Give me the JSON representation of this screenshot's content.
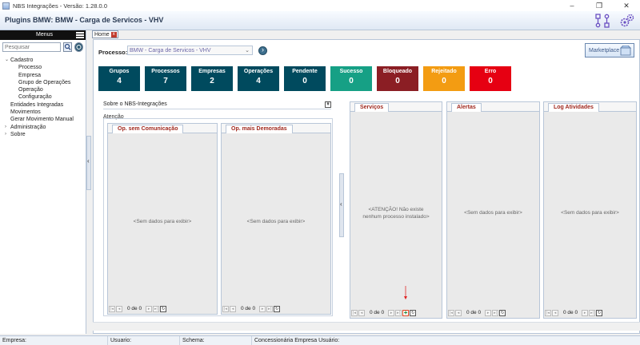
{
  "window": {
    "title": "NBS Integrações - Versão: 1.28.0.0",
    "controls": [
      "–",
      "❐",
      "✕"
    ]
  },
  "header": {
    "title": "Plugins BMW: BMW - Carga de Servicos - VHV",
    "icons": [
      "workflow-icon",
      "gears-icon"
    ]
  },
  "sidebar": {
    "menus_label": "Menus",
    "search_placeholder": "Pesquisar",
    "tree": [
      {
        "label": "Cadastro",
        "level": 0,
        "expand": "⌄"
      },
      {
        "label": "Processo",
        "level": 2,
        "expand": ""
      },
      {
        "label": "Empresa",
        "level": 2,
        "expand": ""
      },
      {
        "label": "Grupo de Operações",
        "level": 2,
        "expand": ""
      },
      {
        "label": "Operação",
        "level": 2,
        "expand": ""
      },
      {
        "label": "Configuração",
        "level": 2,
        "expand": ""
      },
      {
        "label": "Entidades Integradas",
        "level": 1,
        "expand": ""
      },
      {
        "label": "Movimentos",
        "level": 1,
        "expand": ""
      },
      {
        "label": "Gerar Movimento Manual",
        "level": 1,
        "expand": ""
      },
      {
        "label": "Administração",
        "level": 0,
        "expand": "›"
      },
      {
        "label": "Sobre",
        "level": 0,
        "expand": "›"
      }
    ]
  },
  "tabs": {
    "home_label": "Home",
    "close_glyph": "x"
  },
  "process": {
    "label": "Processo:",
    "value": "BMW - Carga de Servicos - VHV",
    "marketplace_label": "Marketplace"
  },
  "tiles": [
    {
      "label": "Grupos",
      "value": "4",
      "color": "#004a5e"
    },
    {
      "label": "Processos",
      "value": "7",
      "color": "#004a5e"
    },
    {
      "label": "Empresas",
      "value": "2",
      "color": "#004a5e"
    },
    {
      "label": "Operações",
      "value": "4",
      "color": "#004a5e"
    },
    {
      "label": "Pendente",
      "value": "0",
      "color": "#004a5e"
    },
    {
      "label": "Sucesso",
      "value": "0",
      "color": "#16a085"
    },
    {
      "label": "Bloqueado",
      "value": "0",
      "color": "#8b1e24"
    },
    {
      "label": "Rejeitado",
      "value": "0",
      "color": "#f39c12"
    },
    {
      "label": "Erro",
      "value": "0",
      "color": "#e60012"
    }
  ],
  "about": {
    "label": "Sobre o NBS-Integrações",
    "expand_glyph": "¥"
  },
  "attention": {
    "label": "Atenção"
  },
  "panels": {
    "op_sem_comunicacao": {
      "title": "Op. sem Comunicação",
      "empty": "<Sem dados para exibir>"
    },
    "op_mais_demoradas": {
      "title": "Op. mais Demoradas",
      "empty": "<Sem dados para exibir>"
    },
    "servicos": {
      "title": "Serviços",
      "empty": "<ATENÇÃO! Não existe nenhum processo instalado>"
    },
    "alertas": {
      "title": "Alertas",
      "empty": "<Sem dados para exibir>"
    },
    "log_atividades": {
      "title": "Log Atividades",
      "empty": "<Sem dados para exibir>"
    }
  },
  "pager": {
    "text": "0 de 0",
    "first": "|◂",
    "prev": "◂",
    "next": "▸",
    "last": "▸|",
    "add": "+",
    "refresh": "↻"
  },
  "statusbar": {
    "empresa": "Empresa:",
    "usuario": "Usuario:",
    "schema": "Schema:",
    "concessionaria": "Concessionária Empresa Usuário:"
  }
}
